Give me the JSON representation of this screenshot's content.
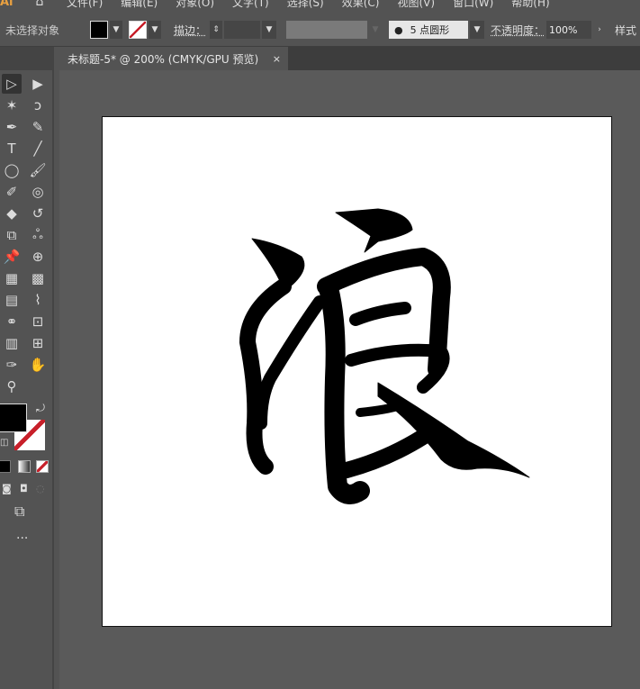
{
  "app": {
    "logo": "Ai"
  },
  "menu": [
    "文件(F)",
    "编辑(E)",
    "对象(O)",
    "文字(T)",
    "选择(S)",
    "效果(C)",
    "视图(V)",
    "窗口(W)",
    "帮助(H)"
  ],
  "control_bar": {
    "selection_status": "未选择对象",
    "fill_color": "#000000",
    "stroke_label": "描边：",
    "brush_label": "5 点圆形",
    "opacity_label": "不透明度：",
    "opacity_value": "100%",
    "style_label": "样式"
  },
  "document_tab": {
    "title": "未标题-5* @ 200% (CMYK/GPU 预览)",
    "close": "×"
  },
  "tools": [
    [
      "selection-tool",
      "▷"
    ],
    [
      "direct-selection-tool",
      "▶"
    ],
    [
      "magic-wand-tool",
      "✶"
    ],
    [
      "lasso-tool",
      "ↄ"
    ],
    [
      "pen-tool",
      "✒"
    ],
    [
      "curvature-tool",
      "✎"
    ],
    [
      "type-tool",
      "T"
    ],
    [
      "line-tool",
      "╱"
    ],
    [
      "ellipse-tool",
      "◯"
    ],
    [
      "paintbrush-tool",
      "🖌"
    ],
    [
      "shaper-tool",
      "✐"
    ],
    [
      "blob-brush-tool",
      "◎"
    ],
    [
      "eraser-tool",
      "◆"
    ],
    [
      "rotate-tool",
      "↺"
    ],
    [
      "scale-tool",
      "⧉"
    ],
    [
      "warp-tool",
      "ஃ"
    ],
    [
      "puppet-warp-tool",
      "📌"
    ],
    [
      "shape-builder-tool",
      "⊕"
    ],
    [
      "perspective-grid-tool",
      "▦"
    ],
    [
      "mesh-tool",
      "▩"
    ],
    [
      "gradient-tool",
      "▤"
    ],
    [
      "eyedropper-tool",
      "⌇"
    ],
    [
      "blend-tool",
      "⚭"
    ],
    [
      "symbol-sprayer-tool",
      "⊡"
    ],
    [
      "column-graph-tool",
      "▥"
    ],
    [
      "artboard-tool",
      "⊞"
    ],
    [
      "slice-tool",
      "✑"
    ],
    [
      "hand-tool",
      "✋"
    ],
    [
      "zoom-tool",
      "⚲"
    ]
  ],
  "colors": {
    "fill": "#000000",
    "stroke": "none",
    "accent_none": "#c8202a",
    "artboard": "#ffffff",
    "workspace": "#5a5a5a"
  },
  "toolbar_more": "···"
}
